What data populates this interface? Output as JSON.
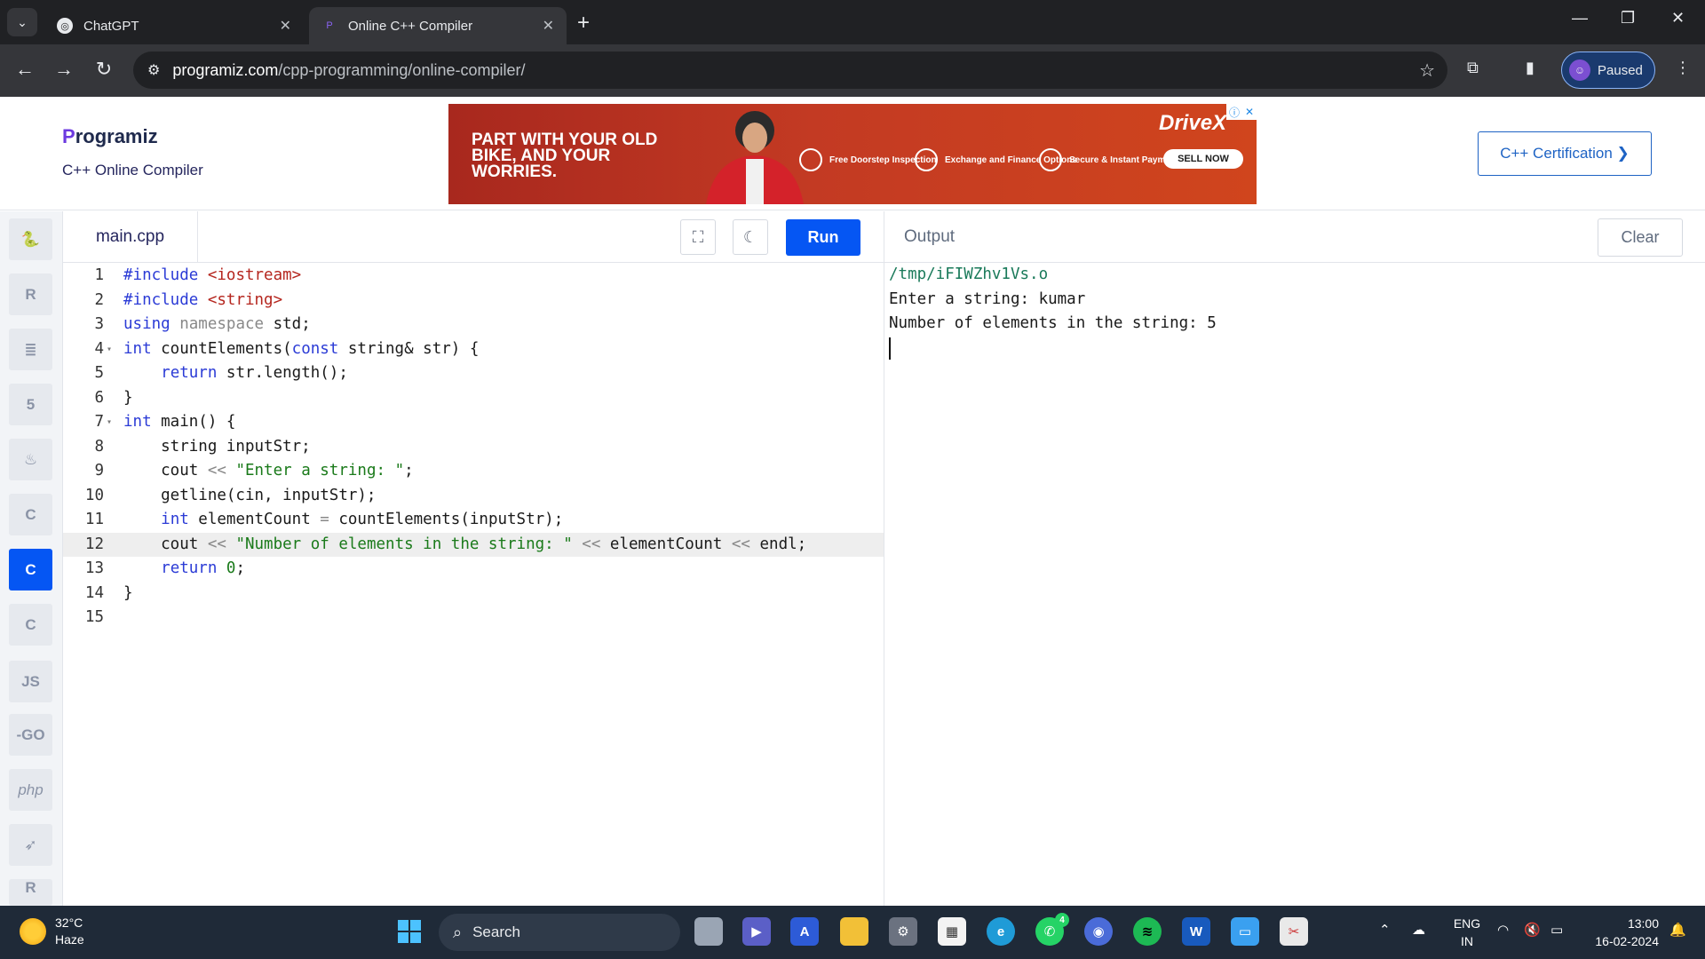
{
  "browser": {
    "tabs": [
      {
        "title": "ChatGPT",
        "active": false
      },
      {
        "title": "Online C++ Compiler",
        "active": true
      }
    ],
    "url_host": "programiz.com",
    "url_path": "/cpp-programming/online-compiler/",
    "profile_label": "Paused"
  },
  "header": {
    "logo_rest": "rogramiz",
    "logo_first": "P",
    "subtitle": "C++ Online Compiler",
    "cert_button": "C++ Certification ❯"
  },
  "ad": {
    "headline": "PART WITH YOUR OLD BIKE, AND YOUR WORRIES.",
    "features": [
      "Free Doorstep Inspection",
      "Exchange and Finance Options",
      "Secure & Instant Payment"
    ],
    "cta": "SELL NOW",
    "brand": "DriveX"
  },
  "languages": [
    {
      "name": "python-icon",
      "label": "",
      "active": false
    },
    {
      "name": "r-icon",
      "label": "R",
      "active": false
    },
    {
      "name": "sql-icon",
      "label": "",
      "active": false
    },
    {
      "name": "html-icon",
      "label": "5",
      "active": false
    },
    {
      "name": "java-icon",
      "label": "",
      "active": false
    },
    {
      "name": "c-icon",
      "label": "C",
      "active": false
    },
    {
      "name": "cpp-icon",
      "label": "C",
      "active": true
    },
    {
      "name": "csharp-icon",
      "label": "C",
      "active": false
    },
    {
      "name": "js-icon",
      "label": "JS",
      "active": false
    },
    {
      "name": "go-icon",
      "label": "-GO",
      "active": false
    },
    {
      "name": "php-icon",
      "label": "php",
      "active": false
    },
    {
      "name": "swift-icon",
      "label": "",
      "active": false
    },
    {
      "name": "rust-icon",
      "label": "R",
      "active": false
    }
  ],
  "editor": {
    "file_name": "main.cpp",
    "run_label": "Run",
    "highlight_line": 12,
    "lines": [
      "#include <iostream>",
      "#include <string>",
      "using namespace std;",
      "int countElements(const string& str) {",
      "    return str.length();",
      "}",
      "int main() {",
      "    string inputStr;",
      "    cout << \"Enter a string: \";",
      "    getline(cin, inputStr);",
      "    int elementCount = countElements(inputStr);",
      "    cout << \"Number of elements in the string: \" << elementCount << endl;",
      "    return 0;",
      "}",
      ""
    ]
  },
  "output": {
    "title": "Output",
    "clear_label": "Clear",
    "lines": [
      "/tmp/iFIWZhv1Vs.o",
      "Enter a string: kumar",
      "Number of elements in the string: 5"
    ]
  },
  "taskbar": {
    "temperature": "32°C",
    "weather": "Haze",
    "search_placeholder": "Search",
    "lang_line1": "ENG",
    "lang_line2": "IN",
    "time": "13:00",
    "date": "16-02-2024",
    "whatsapp_badge": "4"
  }
}
